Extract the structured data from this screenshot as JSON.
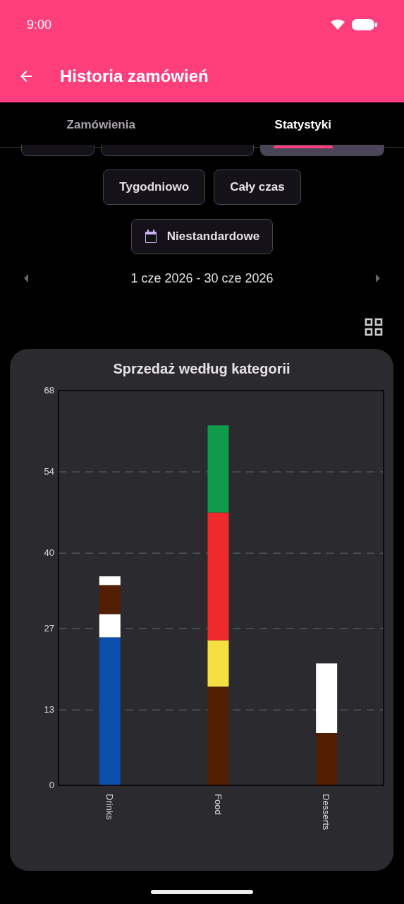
{
  "status_bar": {
    "time": "9:00"
  },
  "app_bar": {
    "title": "Historia zamówień"
  },
  "tabs": [
    {
      "label": "Zamówienia",
      "selected": false
    },
    {
      "label": "Statystyki",
      "selected": true
    }
  ],
  "hidden_chips": [
    {
      "selected": false
    },
    {
      "selected": false
    },
    {
      "selected": true
    }
  ],
  "period_chips": [
    {
      "label": "Tygodniowo",
      "selected": false
    },
    {
      "label": "Cały czas",
      "selected": false
    }
  ],
  "custom_chip": {
    "label": "Niestandardowe",
    "selected": false
  },
  "date_range": "1 cze 2026 - 30 cze 2026",
  "chart_card": {
    "title": "Sprzedaż według kategorii",
    "chart_data": {
      "type": "bar",
      "stacked": true,
      "categories": [
        "Drinks",
        "Food",
        "Desserts"
      ],
      "ylim": [
        0,
        68
      ],
      "yticks": [
        0,
        13,
        27,
        40,
        54,
        68
      ],
      "grid": true,
      "series": [
        {
          "colors": [
            "#0a4fae",
            "#521e02",
            "#521e02"
          ],
          "values": [
            25.5,
            17,
            9
          ]
        },
        {
          "colors": [
            "#ffffff",
            "#f4e040",
            "#ffffff"
          ],
          "values": [
            4,
            8,
            12
          ]
        },
        {
          "colors": [
            "#521e02",
            "#ee2a2a",
            null
          ],
          "values": [
            5,
            22,
            null
          ]
        },
        {
          "colors": [
            "#ffffff",
            "#0e9b4a",
            null
          ],
          "values": [
            1.5,
            15,
            null
          ]
        }
      ]
    }
  }
}
